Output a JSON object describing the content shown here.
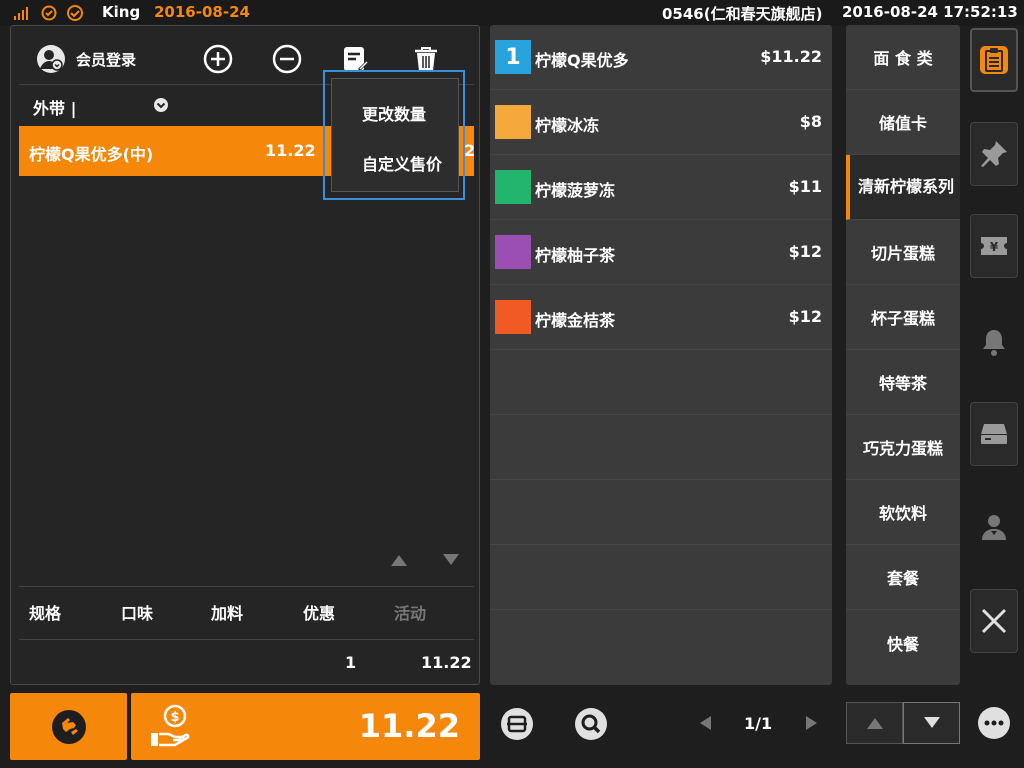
{
  "topbar": {
    "user": "King",
    "date": "2016-08-24",
    "store": "0546(仁和春天旗舰店)",
    "datetime": "2016-08-24 17:52:13"
  },
  "order": {
    "member_login": "会员登录",
    "type": "外带 |",
    "items": [
      {
        "name": "柠檬Q果优多(中)",
        "price": "11.22",
        "qty_clip": "2"
      }
    ],
    "detail_tabs": [
      "规格",
      "口味",
      "加料",
      "优惠",
      "活动"
    ],
    "total_qty": "1",
    "total_amount": "11.22"
  },
  "popup": {
    "items": [
      "更改数量",
      "自定义售价"
    ]
  },
  "products": [
    {
      "badge": "1",
      "name": "柠檬Q果优多",
      "price": "$11.22",
      "color": "#29a3dc"
    },
    {
      "badge": "",
      "name": "柠檬冰冻",
      "price": "$8",
      "color": "#f5a93a"
    },
    {
      "badge": "",
      "name": "柠檬菠萝冻",
      "price": "$11",
      "color": "#21b56e"
    },
    {
      "badge": "",
      "name": "柠檬柚子茶",
      "price": "$12",
      "color": "#9b4fb5"
    },
    {
      "badge": "",
      "name": "柠檬金桔茶",
      "price": "$12",
      "color": "#f15a24"
    }
  ],
  "categories": [
    "面 食 类",
    "储值卡",
    "清新柠檬系列",
    "切片蛋糕",
    "杯子蛋糕",
    "特等茶",
    "巧克力蛋糕",
    "软饮料",
    "套餐",
    "快餐"
  ],
  "selected_category": 2,
  "sidebar_icons": [
    "clipboard-icon",
    "pin-icon",
    "yen-ticket-icon",
    "bell-icon",
    "drawer-icon",
    "person-icon",
    "close-icon",
    "more-icon"
  ],
  "bottom": {
    "pay_amount": "11.22",
    "page": "1/1"
  },
  "colors": {
    "accent": "#f5870a",
    "highlight_border": "#3a8fd8"
  }
}
